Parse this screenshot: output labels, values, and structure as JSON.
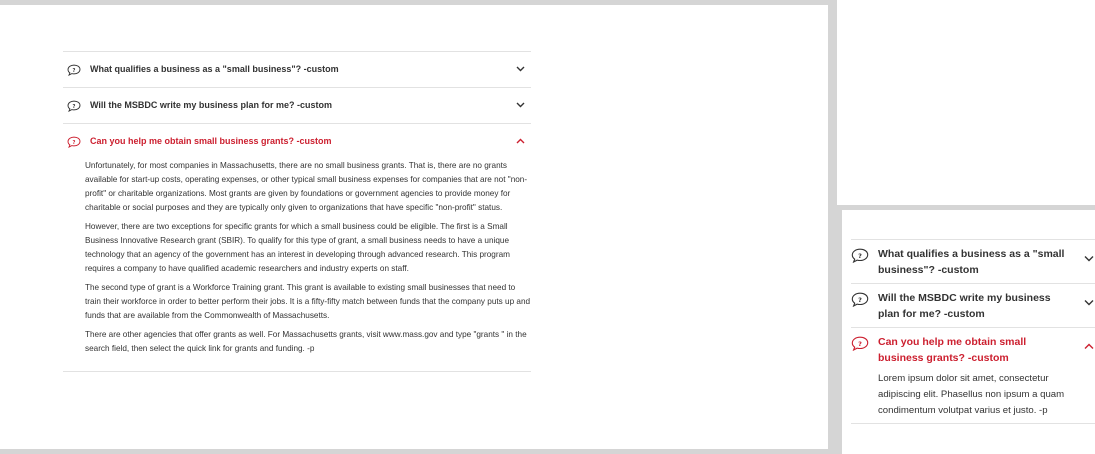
{
  "colors": {
    "accent": "#cc1f2f",
    "text": "#333333",
    "divider": "#e2e2e2",
    "frame": "#d5d5d5"
  },
  "desktop": {
    "faq": [
      {
        "question": "What qualifies a business as a \"small business\"? -custom",
        "icon": "chat-question-icon",
        "chevron": "chevron-down-icon",
        "expanded": false
      },
      {
        "question": "Will the MSBDC write my business plan for me? -custom",
        "icon": "chat-question-icon",
        "chevron": "chevron-down-icon",
        "expanded": false
      },
      {
        "question": "Can you help me obtain small business grants? -custom",
        "icon": "chat-question-icon",
        "chevron": "chevron-up-icon",
        "expanded": true,
        "answer": [
          "Unfortunately, for most companies in Massachusetts, there are no small business grants. That is, there are no grants available for start-up costs, operating expenses, or other typical small business expenses for companies that are not \"non-profit\" or charitable organizations. Most grants are given by foundations or government agencies to provide money for charitable or social purposes and they are typically only given to organizations that have specific \"non-profit\" status.",
          "However, there are two exceptions for specific grants for which a small business could be eligible. The first is a Small Business Innovative Research grant (SBIR). To qualify for this type of grant, a small business needs to have a unique technology that an agency of the government has an interest in developing through advanced research. This program requires a company to have qualified academic researchers and industry experts on staff.",
          "The second type of grant is a Workforce Training grant. This grant is available to existing small businesses that need to train their workforce in order to better perform their jobs.  It is a fifty-fifty match between funds that the company puts up and funds that are available from the Commonwealth of Massachusetts.",
          "There are other agencies that offer grants as well. For Massachusetts grants, visit www.mass.gov and type \"grants \" in the search field, then select the quick link for grants and funding. -p"
        ]
      }
    ]
  },
  "mobile": {
    "faq": [
      {
        "question": "What qualifies a business as a \"small business\"? -custom",
        "icon": "chat-question-icon",
        "chevron": "chevron-down-icon",
        "expanded": false
      },
      {
        "question": "Will the MSBDC write my business plan for me? -custom",
        "icon": "chat-question-icon",
        "chevron": "chevron-down-icon",
        "expanded": false
      },
      {
        "question": "Can you help me obtain small business grants? -custom",
        "icon": "chat-question-icon",
        "chevron": "chevron-up-icon",
        "expanded": true,
        "answer": [
          "Lorem ipsum dolor sit amet, consectetur adipiscing elit. Phasellus non ipsum a quam condimentum volutpat varius et justo. -p"
        ]
      }
    ]
  }
}
